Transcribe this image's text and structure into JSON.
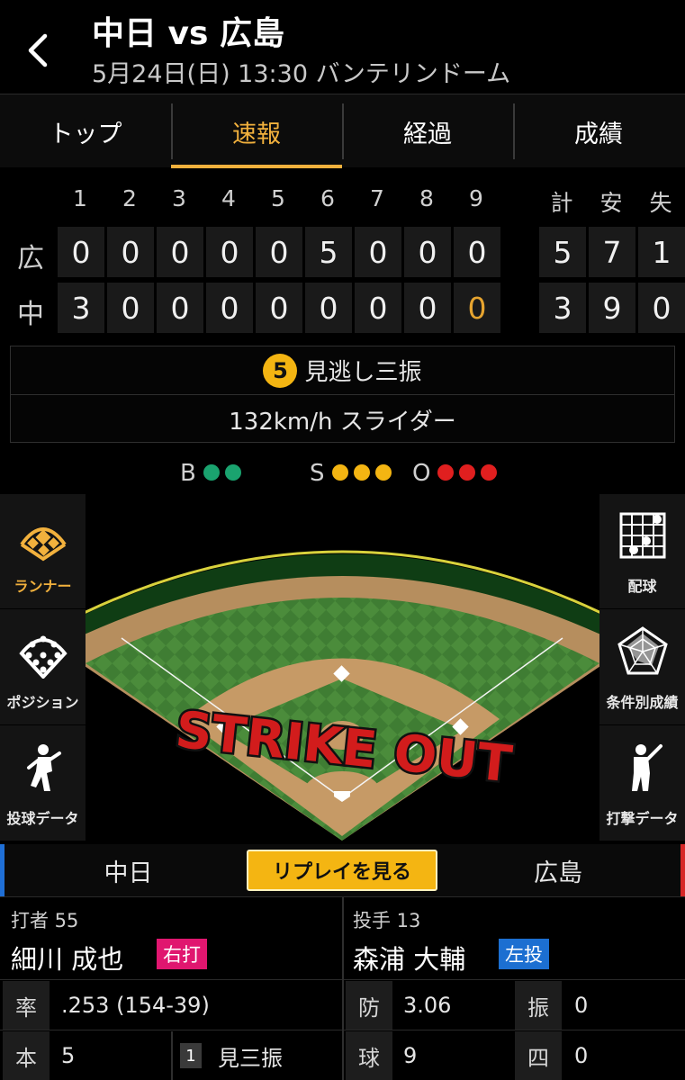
{
  "header": {
    "title": "中日 vs 広島",
    "subtitle": "5月24日(日) 13:30 バンテリンドーム"
  },
  "tabs": [
    {
      "label": "トップ",
      "active": false
    },
    {
      "label": "速報",
      "active": true
    },
    {
      "label": "経過",
      "active": false
    },
    {
      "label": "成績",
      "active": false
    }
  ],
  "scoreboard": {
    "innings": [
      "1",
      "2",
      "3",
      "4",
      "5",
      "6",
      "7",
      "8",
      "9"
    ],
    "totals_headers": [
      "計",
      "安",
      "失"
    ],
    "teams": [
      {
        "name": "広",
        "runs": [
          "0",
          "0",
          "0",
          "0",
          "0",
          "5",
          "0",
          "0",
          "0"
        ],
        "totals": [
          "5",
          "7",
          "1"
        ]
      },
      {
        "name": "中",
        "runs": [
          "3",
          "0",
          "0",
          "0",
          "0",
          "0",
          "0",
          "0",
          "0"
        ],
        "totals": [
          "3",
          "9",
          "0"
        ]
      }
    ],
    "current_inning_highlight": {
      "team_index": 1,
      "inning_index": 8
    }
  },
  "play": {
    "pitch_number": "5",
    "result": "見逃し三振",
    "pitch_info": "132km/h スライダー"
  },
  "count": {
    "ball_label": "B",
    "strike_label": "S",
    "out_label": "O",
    "balls": 2,
    "strikes": 3,
    "outs": 3,
    "colors": {
      "ball": "#1aa36f",
      "strike": "#f4b512",
      "out": "#e01f1f"
    }
  },
  "field": {
    "banner": "STRIKE OUT"
  },
  "left_panel": [
    {
      "label": "ランナー",
      "icon": "runner-diamond-icon",
      "active": true
    },
    {
      "label": "ポジション",
      "icon": "position-icon",
      "active": false
    },
    {
      "label": "投球データ",
      "icon": "pitcher-icon",
      "active": false
    }
  ],
  "right_panel": [
    {
      "label": "配球",
      "icon": "pitch-grid-icon"
    },
    {
      "label": "条件別成績",
      "icon": "radar-chart-icon"
    },
    {
      "label": "打撃データ",
      "icon": "batter-icon"
    }
  ],
  "team_bar": {
    "home": "中日",
    "away": "広島",
    "replay_label": "リプレイを見る",
    "colors": {
      "home": "#1f6fd6",
      "away": "#d62828",
      "replay": "#f4b512"
    }
  },
  "batter": {
    "role": "打者 55",
    "name": "細川 成也",
    "hand": "右打",
    "hand_color": "#e0166f",
    "stats": [
      {
        "label": "率",
        "value": ".253 (154-39)"
      },
      {
        "label": "本",
        "value": "5"
      }
    ],
    "at_bats": [
      {
        "index": "1",
        "result": "見三振"
      }
    ]
  },
  "pitcher": {
    "role": "投手 13",
    "name": "森浦 大輔",
    "hand": "左投",
    "hand_color": "#1c6fd1",
    "stats": [
      {
        "label": "防",
        "value": "3.06"
      },
      {
        "label": "振",
        "value": "0"
      },
      {
        "label": "球",
        "value": "9"
      },
      {
        "label": "四",
        "value": "0"
      }
    ]
  }
}
